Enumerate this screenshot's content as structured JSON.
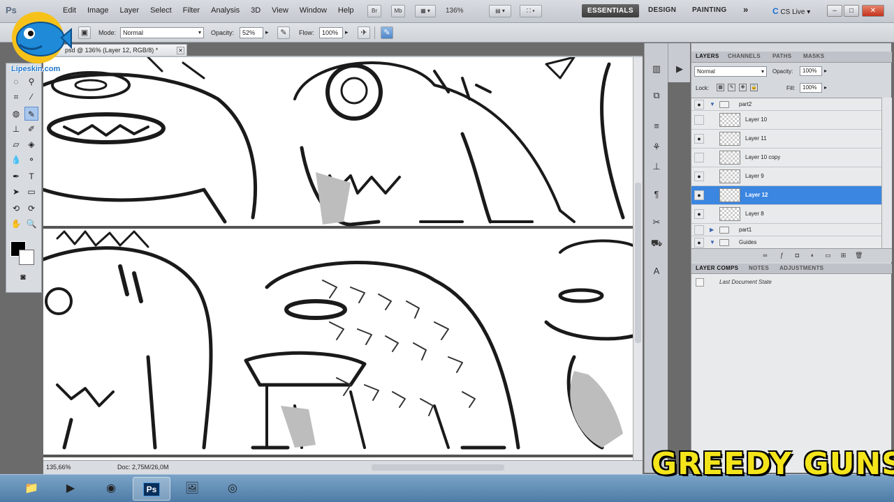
{
  "menubar": {
    "app_logo": "Ps",
    "menus": [
      "Edit",
      "Image",
      "Layer",
      "Select",
      "Filter",
      "Analysis",
      "3D",
      "View",
      "Window",
      "Help"
    ],
    "bridge_label": "Br",
    "mini_bridge_label": "Mb",
    "zoom": "136%",
    "workspaces": [
      "ESSENTIALS",
      "DESIGN",
      "PAINTING"
    ],
    "more": "»",
    "cs_live": "CS Live",
    "window_buttons": [
      "–",
      "□",
      "✕"
    ]
  },
  "options_bar": {
    "mode_label": "Mode:",
    "mode_value": "Normal",
    "opacity_label": "Opacity:",
    "opacity_value": "52%",
    "flow_label": "Flow:",
    "flow_value": "100%"
  },
  "logo": {
    "url": "Lipeskin.com"
  },
  "document": {
    "tab_title": "psd @ 136% (Layer 12, RGB/8) *",
    "zoom": "135,66%",
    "doc_info": "Doc: 2,75M/26,0M"
  },
  "panels": {
    "layers_tabs": [
      "LAYERS",
      "CHANNELS",
      "PATHS",
      "MASKS"
    ],
    "blend_mode": "Normal",
    "opacity_label": "Opacity:",
    "opacity_value": "100%",
    "lock_label": "Lock:",
    "fill_label": "Fill:",
    "fill_value": "100%",
    "layers": [
      {
        "name": "part2",
        "type": "group",
        "visible": true,
        "expanded": true
      },
      {
        "name": "Layer 10",
        "type": "layer",
        "visible": false
      },
      {
        "name": "Layer 11",
        "type": "layer",
        "visible": true
      },
      {
        "name": "Layer 10 copy",
        "type": "layer",
        "visible": false
      },
      {
        "name": "Layer 9",
        "type": "layer",
        "visible": true
      },
      {
        "name": "Layer 12",
        "type": "layer",
        "visible": true,
        "selected": true
      },
      {
        "name": "Layer 8",
        "type": "layer",
        "visible": true
      },
      {
        "name": "part1",
        "type": "group",
        "visible": false,
        "expanded": false
      },
      {
        "name": "Guides",
        "type": "group",
        "visible": true,
        "expanded": true
      }
    ],
    "comps_tabs": [
      "LAYER COMPS",
      "NOTES",
      "ADJUSTMENTS"
    ],
    "last_state": "Last Document State"
  },
  "taskbar": {
    "items": [
      "explorer-icon",
      "media-player-icon",
      "chrome-icon",
      "photoshop-icon",
      "screen-capture-icon",
      "obs-icon"
    ],
    "ps_label": "Ps"
  },
  "watermark": {
    "text": "GREEDY GUNS"
  },
  "colors": {
    "selection": "#3b86e0",
    "watermark": "#f4e51b",
    "active_workspace": "#4a4a4a"
  }
}
